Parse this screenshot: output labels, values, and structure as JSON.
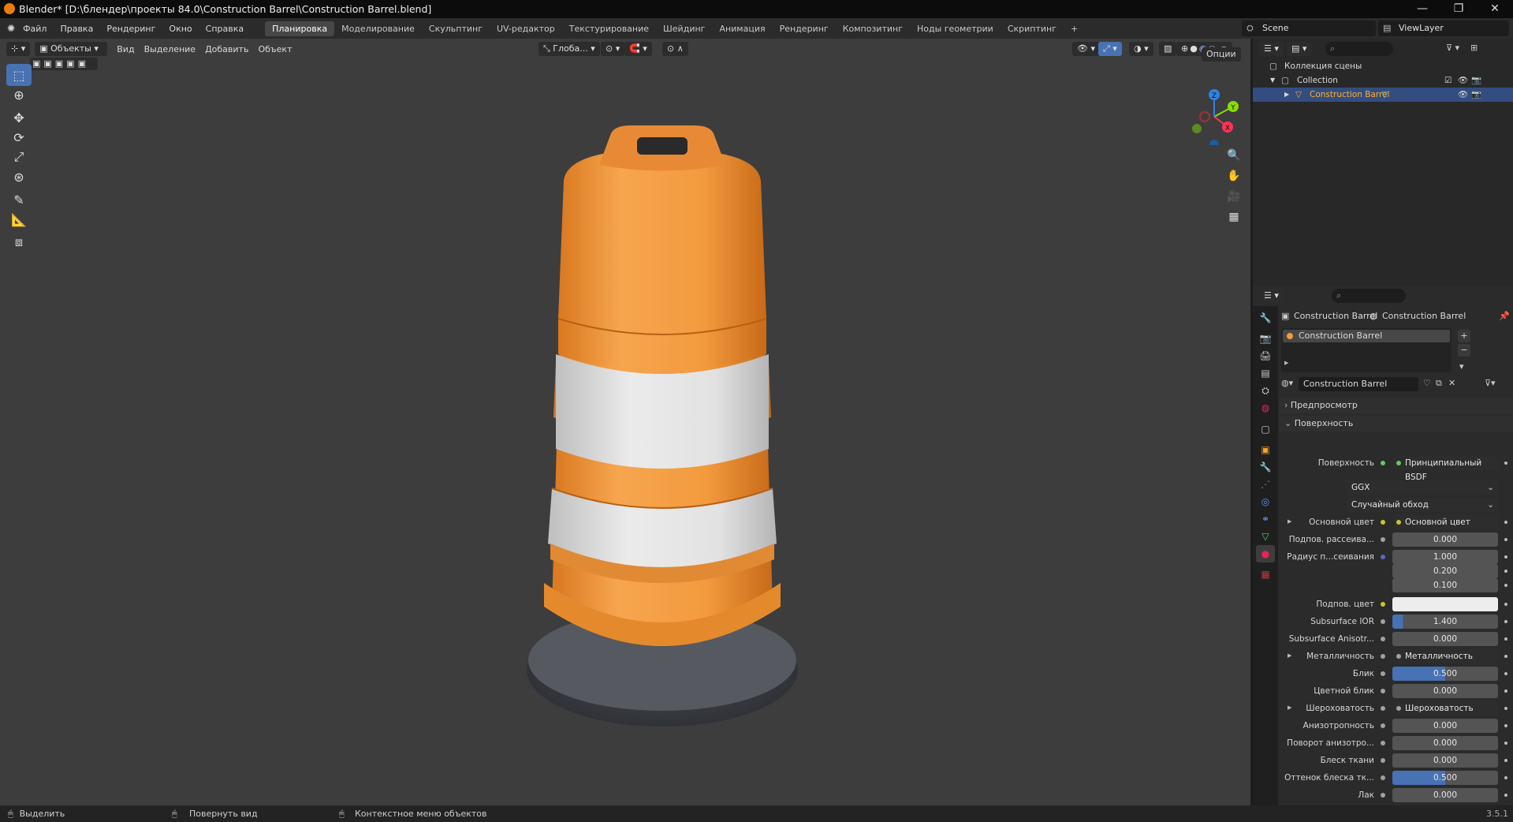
{
  "window": {
    "title": "Blender* [D:\\блендер\\проекты 84.0\\Construction Barrel\\Construction Barrel.blend]",
    "minimize": "—",
    "maximize": "❐",
    "close": "✕"
  },
  "menu": [
    "Файл",
    "Правка",
    "Рендеринг",
    "Окно",
    "Справка"
  ],
  "workspaces": [
    {
      "label": "Планировка",
      "active": true
    },
    {
      "label": "Моделирование"
    },
    {
      "label": "Скульптинг"
    },
    {
      "label": "UV-редактор"
    },
    {
      "label": "Текстурирование"
    },
    {
      "label": "Шейдинг"
    },
    {
      "label": "Анимация"
    },
    {
      "label": "Рендеринг"
    },
    {
      "label": "Композитинг"
    },
    {
      "label": "Ноды геометрии"
    },
    {
      "label": "Скриптинг"
    }
  ],
  "add_workspace": "+",
  "scene": "Scene",
  "view_layer": "ViewLayer",
  "viewport": {
    "mode": "Объекты",
    "menus": [
      "Вид",
      "Выделение",
      "Добавить",
      "Объект"
    ],
    "transform_orientation": "Глоба...",
    "options": "Опции",
    "gizmo_axes": [
      "X",
      "Y",
      "Z"
    ]
  },
  "outliner": {
    "scene_collection": "Коллекция сцены",
    "collection": "Collection",
    "object": "Construction Barrel"
  },
  "properties": {
    "breadcrumb_object": "Construction Barrel",
    "breadcrumb_material": "Construction Barrel",
    "material_slot": "Construction Barrel",
    "material_name": "Construction Barrel",
    "panel_preview": "Предпросмотр",
    "panel_surface": "Поверхность",
    "rows": [
      {
        "label": "Поверхность",
        "value": "Принципиальный BSDF",
        "kind": "link",
        "dot": "#63c763"
      },
      {
        "label": "",
        "value": "GGX",
        "kind": "drop"
      },
      {
        "label": "",
        "value": "Случайный обход",
        "kind": "drop"
      },
      {
        "label": "Основной цвет",
        "value": "Основной цвет",
        "kind": "link",
        "dot": "#c7c729",
        "expand": true
      },
      {
        "label": "Подпов. рассеива...",
        "value": "0.000",
        "kind": "num",
        "dot": "#a1a1a1"
      },
      {
        "label": "Радиус п...сеивания",
        "value": "1.000",
        "kind": "num",
        "dot": "#6363c7"
      },
      {
        "label": "",
        "value": "0.200",
        "kind": "num"
      },
      {
        "label": "",
        "value": "0.100",
        "kind": "num"
      },
      {
        "label": "Подпов. цвет",
        "value": "",
        "kind": "color",
        "dot": "#c7c729"
      },
      {
        "label": "Subsurface IOR",
        "value": "1.400",
        "kind": "num",
        "dot": "#a1a1a1",
        "fill": 0.1
      },
      {
        "label": "Subsurface Anisotr...",
        "value": "0.000",
        "kind": "num",
        "dot": "#a1a1a1"
      },
      {
        "label": "Металличность",
        "value": "Металличность",
        "kind": "link",
        "dot": "#a1a1a1",
        "expand": true
      },
      {
        "label": "Блик",
        "value": "0.500",
        "kind": "num",
        "dot": "#a1a1a1",
        "fill": 0.5
      },
      {
        "label": "Цветной блик",
        "value": "0.000",
        "kind": "num",
        "dot": "#a1a1a1"
      },
      {
        "label": "Шероховатость",
        "value": "Шероховатость",
        "kind": "link",
        "dot": "#a1a1a1",
        "expand": true
      },
      {
        "label": "Анизотропность",
        "value": "0.000",
        "kind": "num",
        "dot": "#a1a1a1"
      },
      {
        "label": "Поворот анизотро...",
        "value": "0.000",
        "kind": "num",
        "dot": "#a1a1a1"
      },
      {
        "label": "Блеск ткани",
        "value": "0.000",
        "kind": "num",
        "dot": "#a1a1a1"
      },
      {
        "label": "Оттенок блеска тк...",
        "value": "0.500",
        "kind": "num",
        "dot": "#a1a1a1",
        "fill": 0.5
      },
      {
        "label": "Лак",
        "value": "0.000",
        "kind": "num",
        "dot": "#a1a1a1"
      }
    ]
  },
  "status": {
    "select": "Выделить",
    "rotate": "Повернуть вид",
    "context": "Контекстное меню объектов",
    "version": "3.5.1"
  },
  "colors": {
    "accent": "#4772b3",
    "orange": "#f29b3a",
    "selected_text": "#ffaf29"
  }
}
